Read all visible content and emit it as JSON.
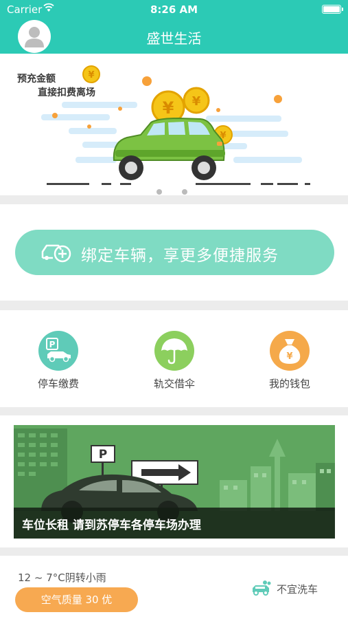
{
  "status_bar": {
    "carrier": "Carrier",
    "time": "8:26 AM"
  },
  "nav": {
    "title": "盛世生活"
  },
  "banner": {
    "line1": "预充金额",
    "line2": "直接扣费离场",
    "coin_symbol": "¥"
  },
  "bind": {
    "label": "绑定车辆，享更多便捷服务"
  },
  "services": [
    {
      "label": "停车缴费",
      "icon": "parking-car-icon",
      "color": "#5fcbb8"
    },
    {
      "label": "轨交借伞",
      "icon": "umbrella-icon",
      "color": "#8ccf5e"
    },
    {
      "label": "我的钱包",
      "icon": "money-bag-icon",
      "color": "#f5a94a"
    }
  ],
  "ad": {
    "caption": "车位长租 请到苏停车各停车场办理",
    "sign": "P"
  },
  "weather": {
    "temperature": "12 ~ 7°C阴转小雨",
    "air_quality": "空气质量  30  优",
    "car_wash": "不宜洗车"
  },
  "colors": {
    "primary": "#2ccab5",
    "bind_button": "#7fdbc3",
    "air_quality": "#f7a951"
  }
}
